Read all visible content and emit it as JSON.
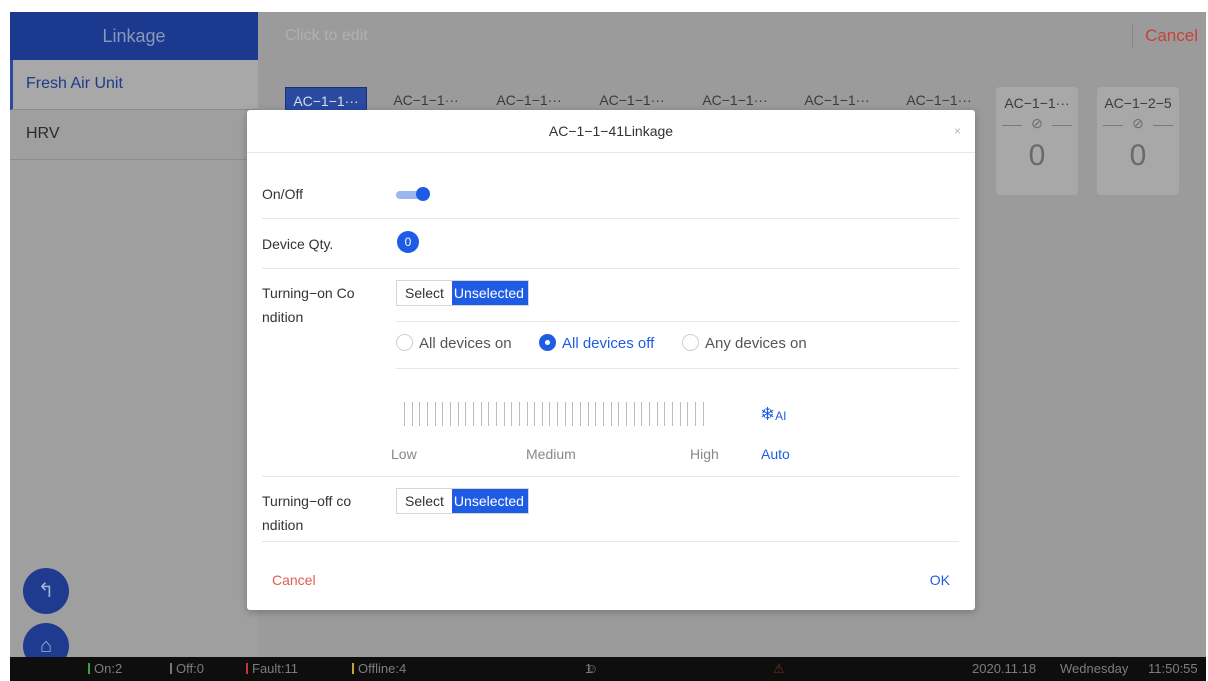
{
  "topbar": {
    "title": "Linkage",
    "edit_placeholder": "Click to edit",
    "cancel": "Cancel"
  },
  "sidebar": {
    "items": [
      {
        "label": "Fresh Air Unit",
        "active": true
      },
      {
        "label": "HRV",
        "active": false
      }
    ]
  },
  "tabs": [
    "AC−1−1···",
    "AC−1−1···",
    "AC−1−1···",
    "AC−1−1···",
    "AC−1−1···",
    "AC−1−1···",
    "AC−1−1···"
  ],
  "tiles": [
    {
      "label": "AC−1−1···",
      "value": "0"
    },
    {
      "label": "AC−1−2−5",
      "value": "0"
    }
  ],
  "statusbar": {
    "on": "On:2",
    "off": "Off:0",
    "fault": "Fault:11",
    "offline": "Offline:4",
    "users": "1",
    "date": "2020.11.18",
    "weekday": "Wednesday",
    "time": "11:50:55"
  },
  "modal": {
    "title": "AC−1−1−41Linkage",
    "close": "×",
    "onoff_label": "On/Off",
    "onoff_value": true,
    "qty_label": "Device Qty.",
    "qty_value": "0",
    "turn_on_label_1": "Turning−on Co",
    "turn_on_label_2": "ndition",
    "turn_off_label_1": "Turning−off co",
    "turn_off_label_2": "ndition",
    "select": "Select",
    "unselected": "Unselected",
    "radios": [
      "All devices on",
      "All devices off",
      "Any devices on"
    ],
    "radio_selected": "All devices off",
    "fan_levels": {
      "low": "Low",
      "medium": "Medium",
      "high": "High",
      "auto": "Auto"
    },
    "cancel": "Cancel",
    "ok": "OK"
  },
  "colors": {
    "accent": "#1e5ce6",
    "danger": "#e05c4e"
  }
}
